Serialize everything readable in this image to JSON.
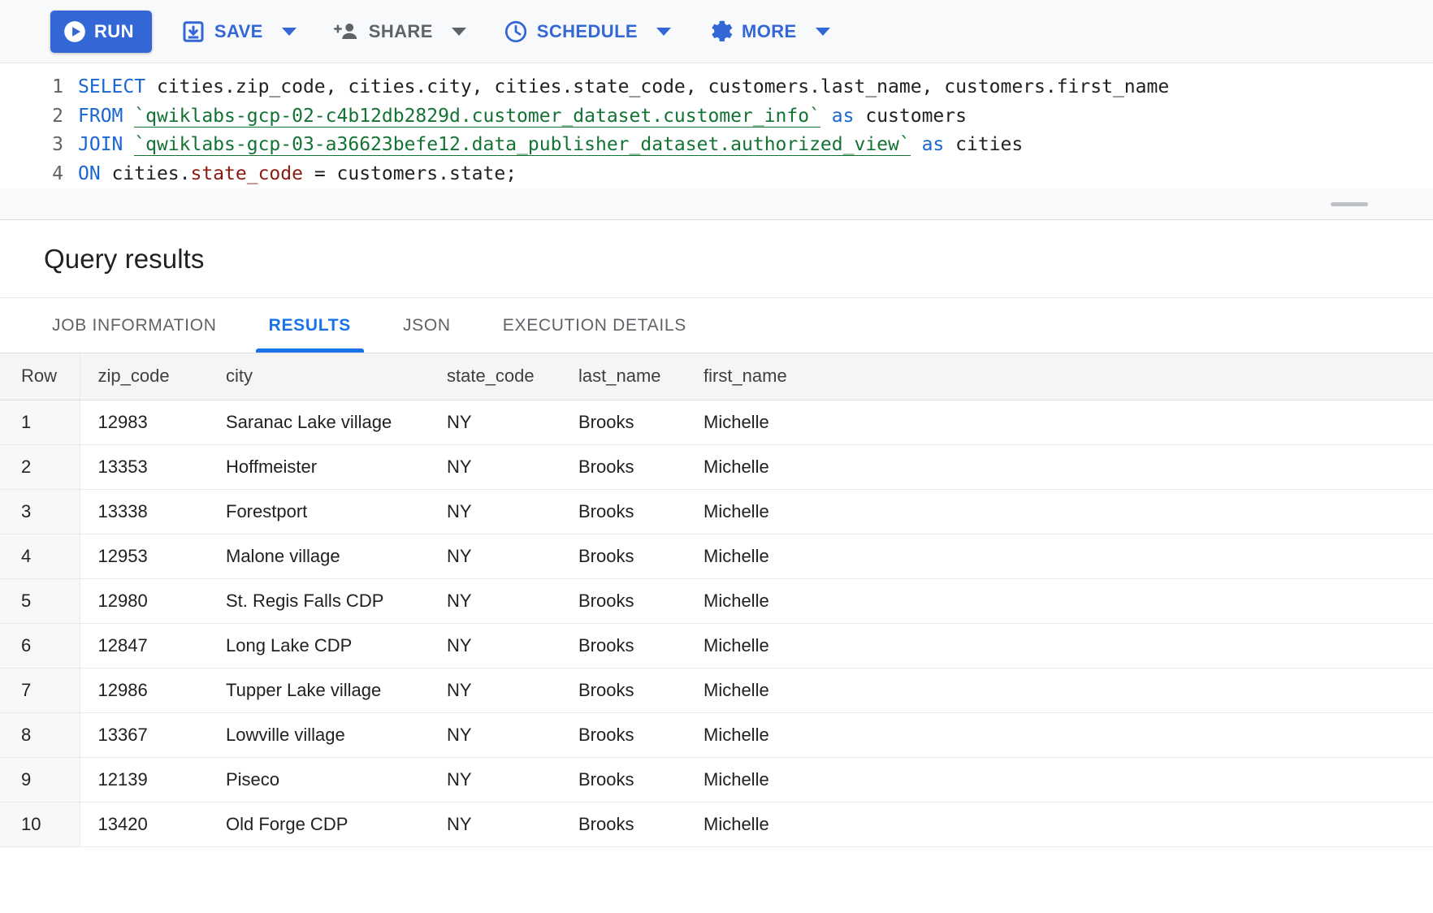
{
  "toolbar": {
    "run": {
      "label": "RUN",
      "icon": "play-circle-icon"
    },
    "save": {
      "label": "SAVE",
      "icon": "save-icon"
    },
    "share": {
      "label": "SHARE",
      "icon": "person-add-icon"
    },
    "schedule": {
      "label": "SCHEDULE",
      "icon": "clock-icon"
    },
    "more": {
      "label": "MORE",
      "icon": "gear-icon"
    },
    "accent_blue": "#3367d6",
    "muted_gray": "#5f6368"
  },
  "editor": {
    "line_numbers": [
      "1",
      "2",
      "3",
      "4"
    ],
    "lines": [
      {
        "n": "1",
        "tokens": [
          {
            "t": "SELECT",
            "c": "kw"
          },
          {
            "t": " cities.zip_code, cities.city, cities.state_code, customers.last_name, customers.first_name",
            "c": "plain"
          }
        ]
      },
      {
        "n": "2",
        "tokens": [
          {
            "t": "FROM",
            "c": "kw"
          },
          {
            "t": " ",
            "c": "plain"
          },
          {
            "t": "`qwiklabs-gcp-02-c4b12db2829d.customer_dataset.customer_info`",
            "c": "tbl"
          },
          {
            "t": " ",
            "c": "plain"
          },
          {
            "t": "as",
            "c": "kw"
          },
          {
            "t": " customers",
            "c": "plain"
          }
        ]
      },
      {
        "n": "3",
        "tokens": [
          {
            "t": "JOIN",
            "c": "kw"
          },
          {
            "t": " ",
            "c": "plain"
          },
          {
            "t": "`qwiklabs-gcp-03-a36623befe12.data_publisher_dataset.authorized_view`",
            "c": "tbl"
          },
          {
            "t": " ",
            "c": "plain"
          },
          {
            "t": "as",
            "c": "kw"
          },
          {
            "t": " cities",
            "c": "plain"
          }
        ]
      },
      {
        "n": "4",
        "tokens": [
          {
            "t": "ON",
            "c": "kw"
          },
          {
            "t": " cities.",
            "c": "plain"
          },
          {
            "t": "state_code",
            "c": "fld"
          },
          {
            "t": " = customers.state;",
            "c": "plain"
          }
        ]
      }
    ],
    "colors": {
      "keyword": "#1967d2",
      "table_ref": "#137333",
      "field": "#8b1a10",
      "plain": "#202124"
    }
  },
  "results": {
    "title": "Query results",
    "tabs": [
      {
        "label": "JOB INFORMATION",
        "active": false
      },
      {
        "label": "RESULTS",
        "active": true
      },
      {
        "label": "JSON",
        "active": false
      },
      {
        "label": "EXECUTION DETAILS",
        "active": false
      }
    ],
    "columns": [
      "Row",
      "zip_code",
      "city",
      "state_code",
      "last_name",
      "first_name"
    ],
    "rows": [
      [
        "1",
        "12983",
        "Saranac Lake village",
        "NY",
        "Brooks",
        "Michelle"
      ],
      [
        "2",
        "13353",
        "Hoffmeister",
        "NY",
        "Brooks",
        "Michelle"
      ],
      [
        "3",
        "13338",
        "Forestport",
        "NY",
        "Brooks",
        "Michelle"
      ],
      [
        "4",
        "12953",
        "Malone village",
        "NY",
        "Brooks",
        "Michelle"
      ],
      [
        "5",
        "12980",
        "St. Regis Falls CDP",
        "NY",
        "Brooks",
        "Michelle"
      ],
      [
        "6",
        "12847",
        "Long Lake CDP",
        "NY",
        "Brooks",
        "Michelle"
      ],
      [
        "7",
        "12986",
        "Tupper Lake village",
        "NY",
        "Brooks",
        "Michelle"
      ],
      [
        "8",
        "13367",
        "Lowville village",
        "NY",
        "Brooks",
        "Michelle"
      ],
      [
        "9",
        "12139",
        "Piseco",
        "NY",
        "Brooks",
        "Michelle"
      ],
      [
        "10",
        "13420",
        "Old Forge CDP",
        "NY",
        "Brooks",
        "Michelle"
      ]
    ]
  }
}
